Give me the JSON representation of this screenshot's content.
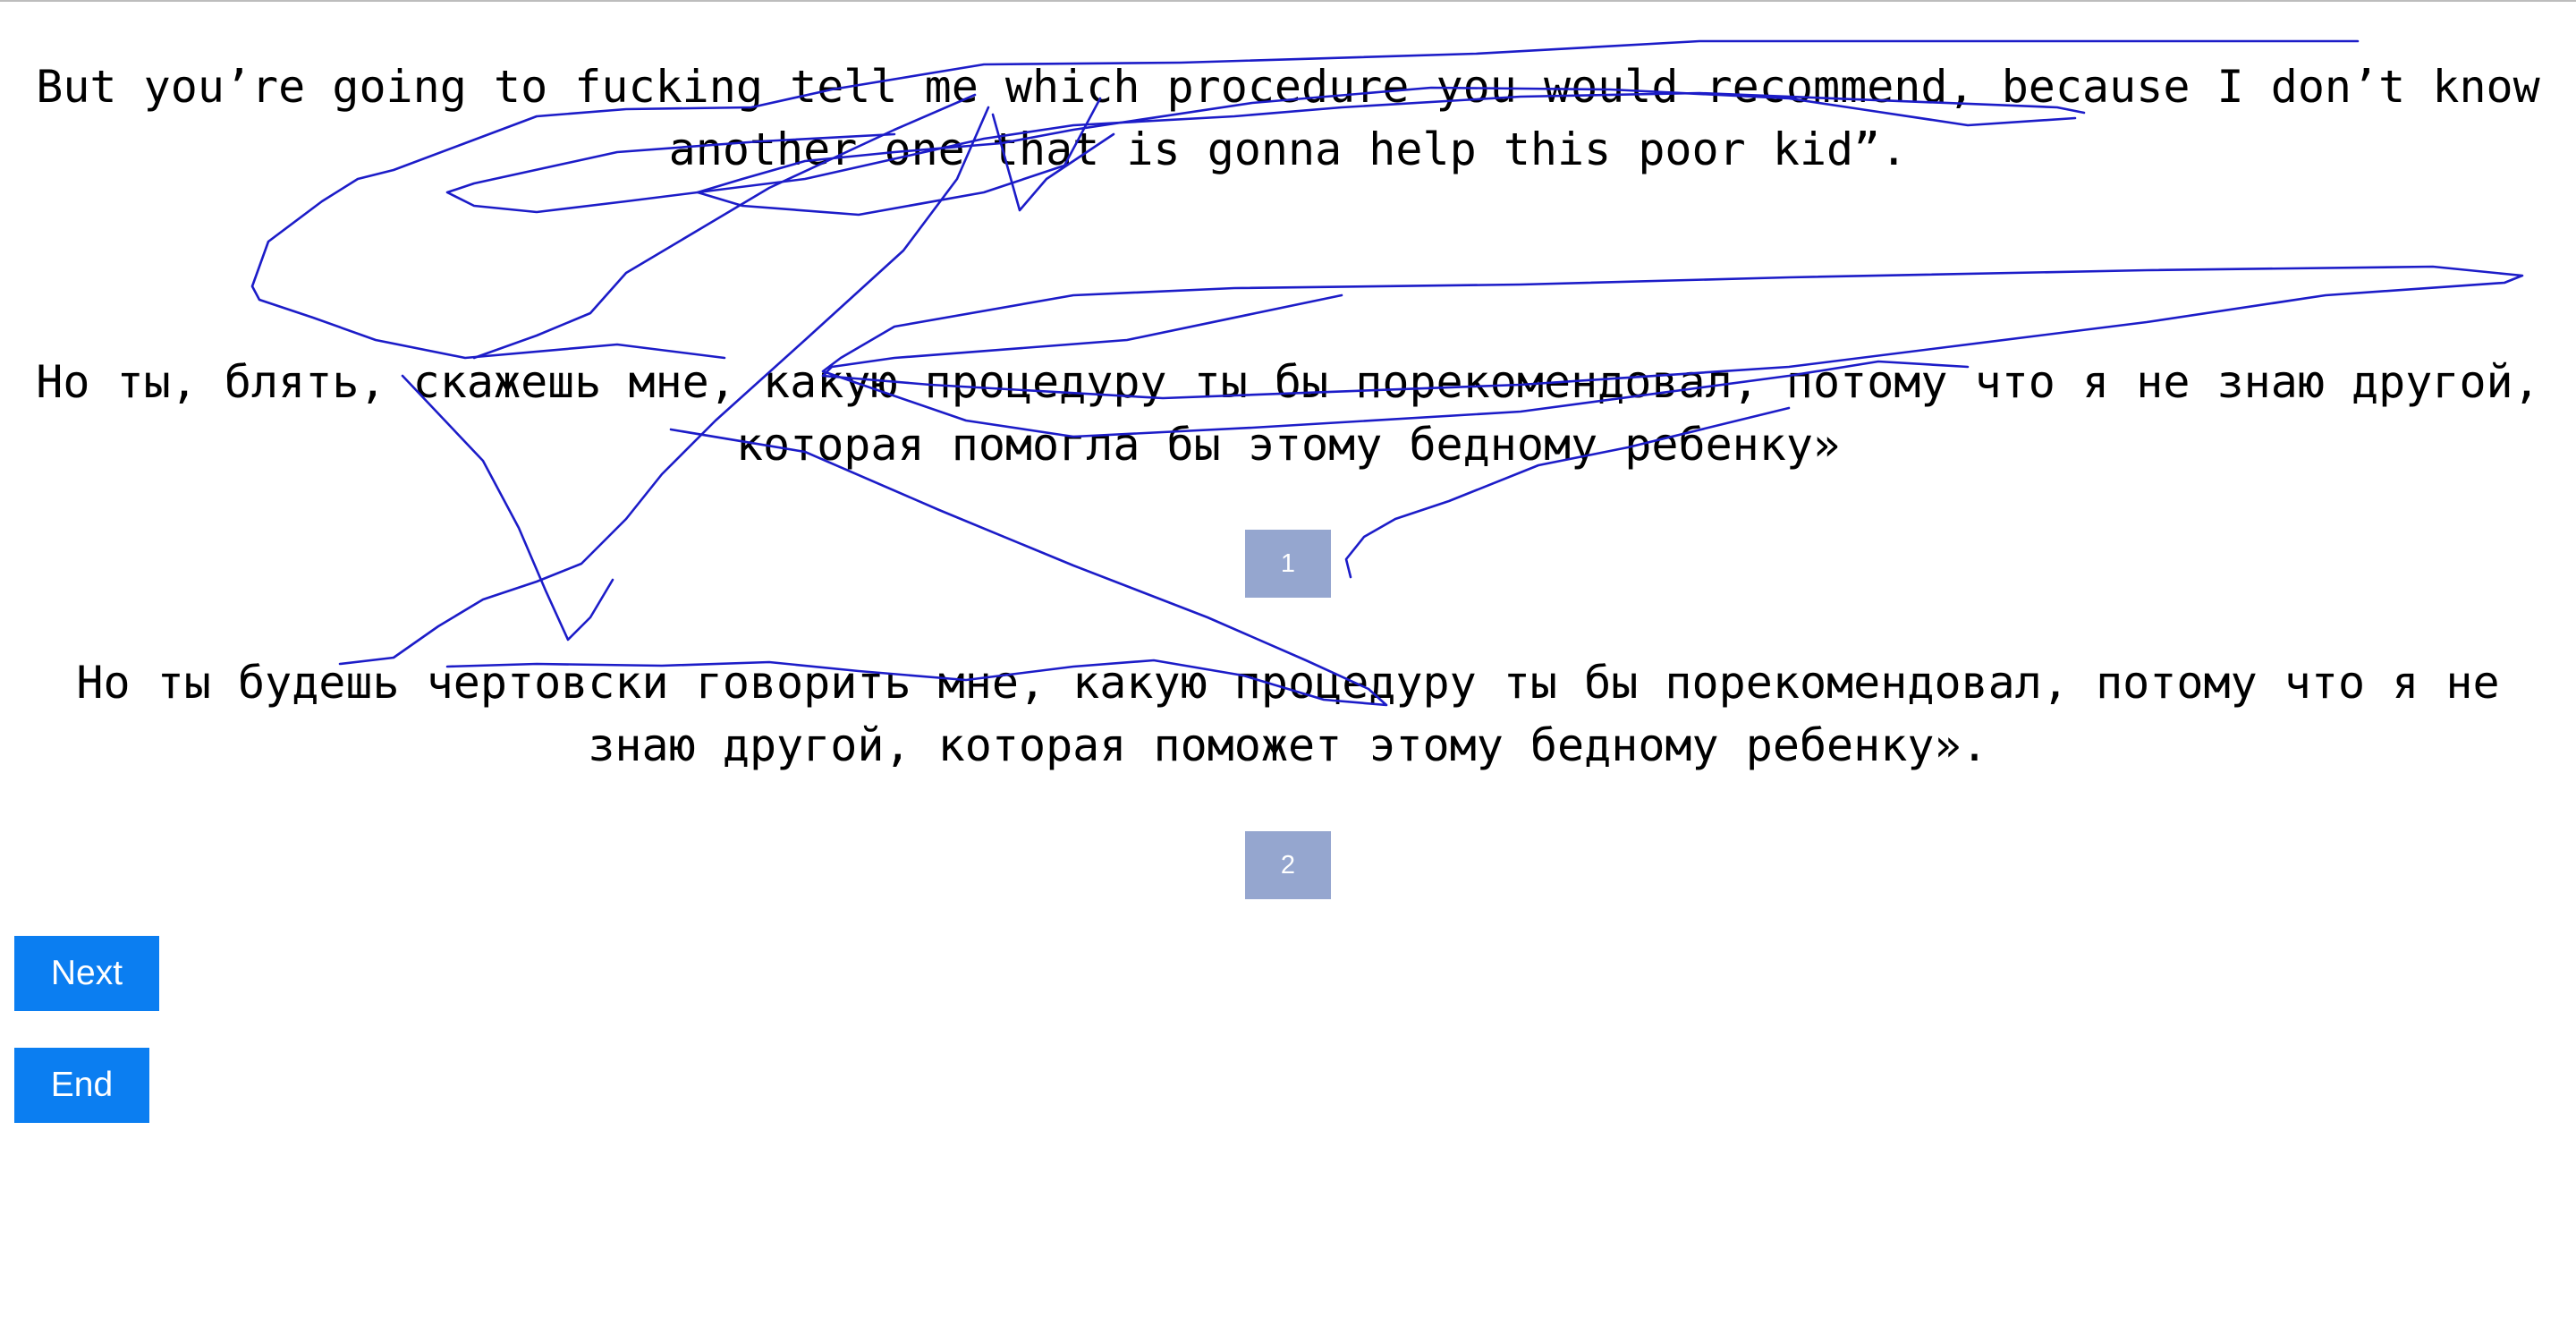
{
  "source_text": "But you’re going to fucking tell me which procedure you would recommend, because I don’t know another one that is gonna help this poor kid”.",
  "translations": [
    {
      "text": "Но ты, блять, скажешь мне, какую процедуру ты бы порекомендовал, потому что я не знаю другой, которая помогла бы этому бедному ребенку»",
      "choice_label": "1"
    },
    {
      "text": "Но ты будешь чертовски говорить мне, какую процедуру ты бы порекомендовал, потому что я не знаю другой, которая поможет этому бедному ребенку».",
      "choice_label": "2"
    }
  ],
  "buttons": {
    "next_label": "Next",
    "end_label": "End"
  },
  "colors": {
    "choice_button": "#95a6cf",
    "action_button": "#0b7ef1",
    "scribble_ink": "#1c1cc8"
  }
}
